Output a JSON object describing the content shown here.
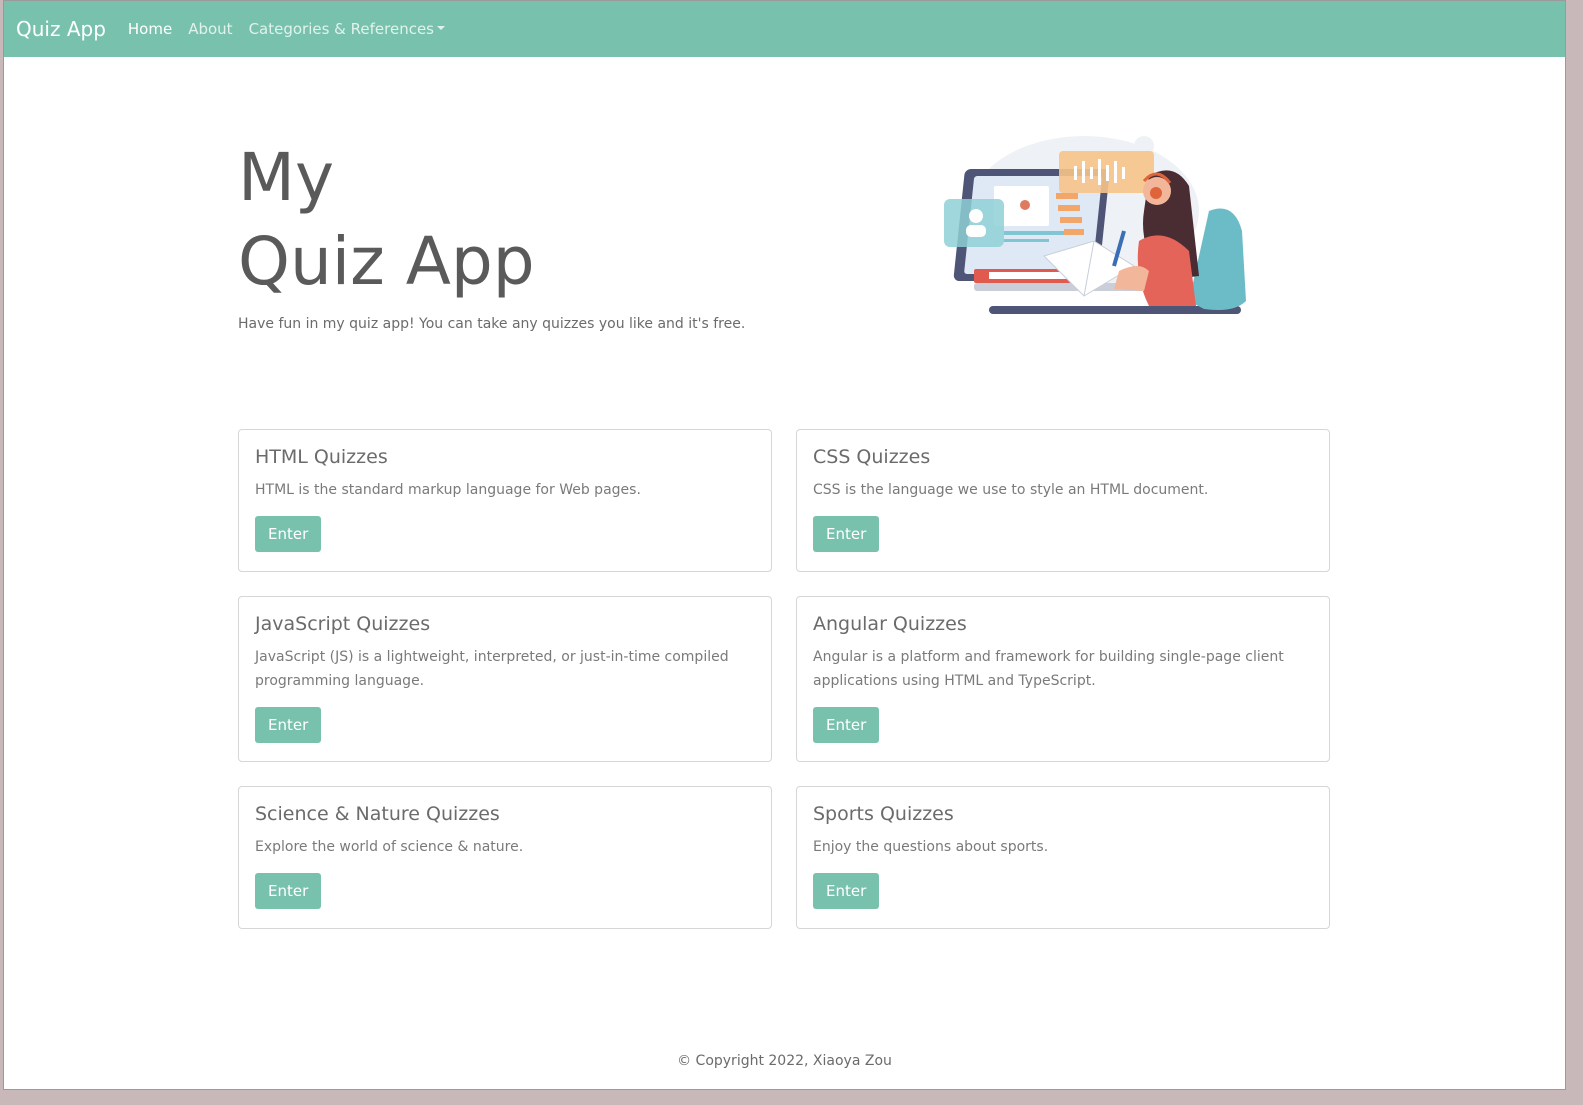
{
  "colors": {
    "primary": "#78c2ad",
    "text_dark": "#5a5a5a",
    "text_muted": "#7a7a7a"
  },
  "navbar": {
    "brand": "Quiz App",
    "links": [
      {
        "label": "Home",
        "active": true
      },
      {
        "label": "About",
        "active": false
      },
      {
        "label": "Categories & References",
        "active": false,
        "dropdown": true
      }
    ]
  },
  "hero": {
    "title_line1": "My",
    "title_line2": "Quiz App",
    "subtitle": "Have fun in my quiz app! You can take any quizzes you like and it's free."
  },
  "illustration": {
    "icon": "student-studying-illustration"
  },
  "cards": [
    {
      "title": "HTML Quizzes",
      "text": "HTML is the standard markup language for Web pages.",
      "button": "Enter"
    },
    {
      "title": "CSS Quizzes",
      "text": "CSS is the language we use to style an HTML document.",
      "button": "Enter"
    },
    {
      "title": "JavaScript Quizzes",
      "text": "JavaScript (JS) is a lightweight, interpreted, or just-in-time compiled programming language.",
      "button": "Enter"
    },
    {
      "title": "Angular Quizzes",
      "text": "Angular is a platform and framework for building single-page client applications using HTML and TypeScript.",
      "button": "Enter"
    },
    {
      "title": "Science & Nature Quizzes",
      "text": "Explore the world of science & nature.",
      "button": "Enter"
    },
    {
      "title": "Sports Quizzes",
      "text": "Enjoy the questions about sports.",
      "button": "Enter"
    }
  ],
  "footer": {
    "text": "© Copyright 2022, Xiaoya Zou"
  }
}
